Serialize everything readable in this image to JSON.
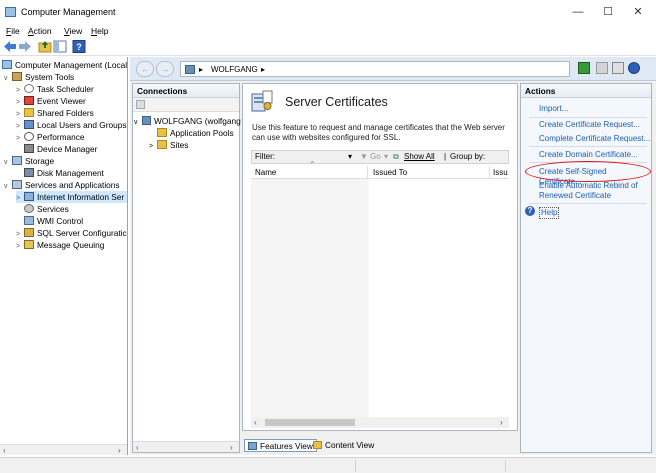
{
  "window": {
    "title": "Computer Management"
  },
  "window_controls": {
    "minimize": "—",
    "maximize": "☐",
    "close": "✕"
  },
  "menu": [
    {
      "label": "File",
      "accel": "F"
    },
    {
      "label": "Action",
      "accel": "A"
    },
    {
      "label": "View",
      "accel": "V"
    },
    {
      "label": "Help",
      "accel": "H"
    }
  ],
  "tree": {
    "items": [
      {
        "label": "Computer Management (Local",
        "level": 0,
        "exp": ""
      },
      {
        "label": "System Tools",
        "level": 1,
        "exp": "v"
      },
      {
        "label": "Task Scheduler",
        "level": 2,
        "exp": ">"
      },
      {
        "label": "Event Viewer",
        "level": 2,
        "exp": ">"
      },
      {
        "label": "Shared Folders",
        "level": 2,
        "exp": ">"
      },
      {
        "label": "Local Users and Groups",
        "level": 2,
        "exp": ">"
      },
      {
        "label": "Performance",
        "level": 2,
        "exp": ">"
      },
      {
        "label": "Device Manager",
        "level": 2,
        "exp": ""
      },
      {
        "label": "Storage",
        "level": 1,
        "exp": "v"
      },
      {
        "label": "Disk Management",
        "level": 2,
        "exp": ""
      },
      {
        "label": "Services and Applications",
        "level": 1,
        "exp": "v"
      },
      {
        "label": "Internet Information Ser",
        "level": 2,
        "exp": ">"
      },
      {
        "label": "Services",
        "level": 2,
        "exp": ""
      },
      {
        "label": "WMI Control",
        "level": 2,
        "exp": ""
      },
      {
        "label": "SQL Server Configuratic",
        "level": 2,
        "exp": ">"
      },
      {
        "label": "Message Queuing",
        "level": 2,
        "exp": ">"
      }
    ]
  },
  "iis": {
    "address": {
      "crumbs": [
        "▸",
        "WOLFGANG",
        "▸"
      ]
    },
    "connections": {
      "title": "Connections",
      "items": [
        {
          "label": "WOLFGANG (wolfgang",
          "level": 0,
          "exp": "v"
        },
        {
          "label": "Application Pools",
          "level": 1,
          "exp": ""
        },
        {
          "label": "Sites",
          "level": 1,
          "exp": ">"
        }
      ]
    },
    "feature": {
      "title": "Server Certificates",
      "description": "Use this feature to request and manage certificates that the Web server can use with websites configured for SSL.",
      "filter_label": "Filter:",
      "go_label": "Go",
      "show_all_label": "Show All",
      "group_by_label": "Group by:",
      "columns": [
        "Name",
        "Issued To",
        "Issu"
      ]
    },
    "view_tabs": [
      "Features View",
      "Content View"
    ],
    "actions": {
      "title": "Actions",
      "items": [
        "Import...",
        "Create Certificate Request...",
        "Complete Certificate Request...",
        "Create Domain Certificate...",
        "Create Self-Signed Certificate...",
        "Enable Automatic Rebind of",
        "Renewed Certificate",
        "Help"
      ]
    }
  },
  "colors": {
    "link": "#1a5fb4",
    "selection": "#cde8ff",
    "highlight": "#dd1111"
  }
}
